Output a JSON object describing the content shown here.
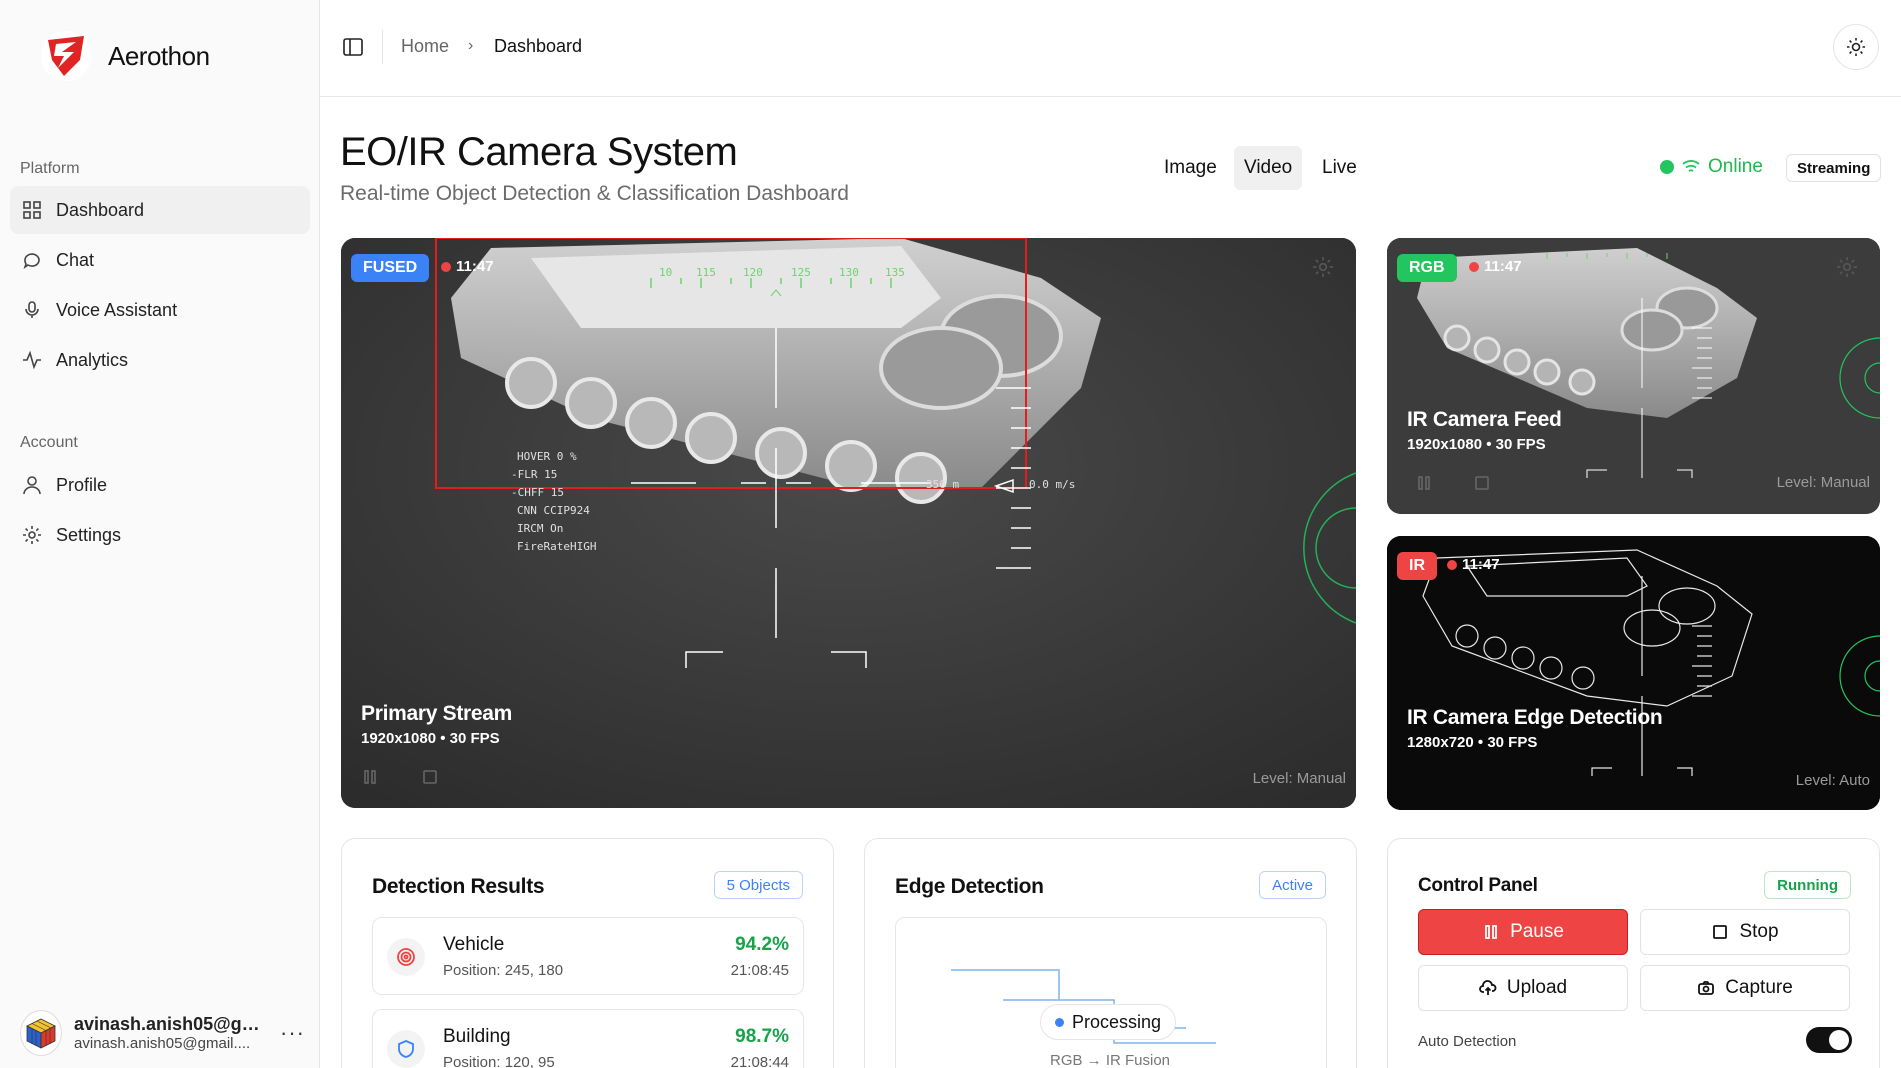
{
  "brand": {
    "name": "Aerothon"
  },
  "breadcrumb": {
    "home": "Home",
    "current": "Dashboard"
  },
  "sidebar": {
    "platform_label": "Platform",
    "platform_items": [
      {
        "label": "Dashboard",
        "icon": "grid-icon",
        "active": true
      },
      {
        "label": "Chat",
        "icon": "chat-icon"
      },
      {
        "label": "Voice Assistant",
        "icon": "mic-icon"
      },
      {
        "label": "Analytics",
        "icon": "activity-icon"
      }
    ],
    "account_label": "Account",
    "account_items": [
      {
        "label": "Profile",
        "icon": "user-icon"
      },
      {
        "label": "Settings",
        "icon": "gear-icon"
      }
    ],
    "user": {
      "name": "avinash.anish05@gm...",
      "email": "avinash.anish05@gmail....",
      "more": "···"
    }
  },
  "header": {
    "title": "EO/IR Camera System",
    "subtitle": "Real-time Object Detection & Classification Dashboard",
    "modes": [
      "Image",
      "Video",
      "Live"
    ],
    "active_mode": "Video",
    "status": "Online",
    "stream_badge": "Streaming"
  },
  "colors": {
    "accent_red": "#ef4444",
    "green": "#22c55e",
    "blue": "#3b82f6"
  },
  "streams": {
    "primary": {
      "tag": "FUSED",
      "tag_color": "#3b82f6",
      "time": "11:47",
      "name": "Primary Stream",
      "resolution": "1920x1080 • 30 FPS",
      "level": "Level: Manual"
    },
    "rgb": {
      "tag": "RGB",
      "tag_color": "#22c55e",
      "time": "11:47",
      "name": "IR Camera Feed",
      "resolution": "1920x1080 • 30 FPS",
      "level": "Level: Manual"
    },
    "ir": {
      "tag": "IR",
      "tag_color": "#ef4444",
      "time": "11:47",
      "name": "IR Camera Edge Detection",
      "resolution": "1280x720 • 30 FPS",
      "level": "Level: Auto"
    }
  },
  "hud": {
    "heading_ticks": [
      "10",
      "115",
      "120",
      "125",
      "130",
      "135"
    ],
    "lines": [
      "HOVER  0 %",
      "-FLR    15",
      "-CHFF   15",
      "CNN  CCIP924",
      "IRCM   On",
      "FireRateHIGH"
    ],
    "range": "356 m",
    "speed": "0.0 m/s"
  },
  "detection": {
    "title": "Detection Results",
    "badge": "5 Objects",
    "items": [
      {
        "name": "Vehicle",
        "position": "Position: 245, 180",
        "confidence": "94.2%",
        "time": "21:08:45"
      },
      {
        "name": "Building",
        "position": "Position: 120, 95",
        "confidence": "98.7%",
        "time": "21:08:44"
      }
    ]
  },
  "edge": {
    "title": "Edge Detection",
    "badge": "Active",
    "processing": "Processing",
    "fusion": "RGB → IR Fusion"
  },
  "control": {
    "title": "Control Panel",
    "badge": "Running",
    "buttons": {
      "pause": "Pause",
      "stop": "Stop",
      "upload": "Upload",
      "capture": "Capture"
    },
    "auto_detection_label": "Auto Detection",
    "auto_detection": true
  }
}
